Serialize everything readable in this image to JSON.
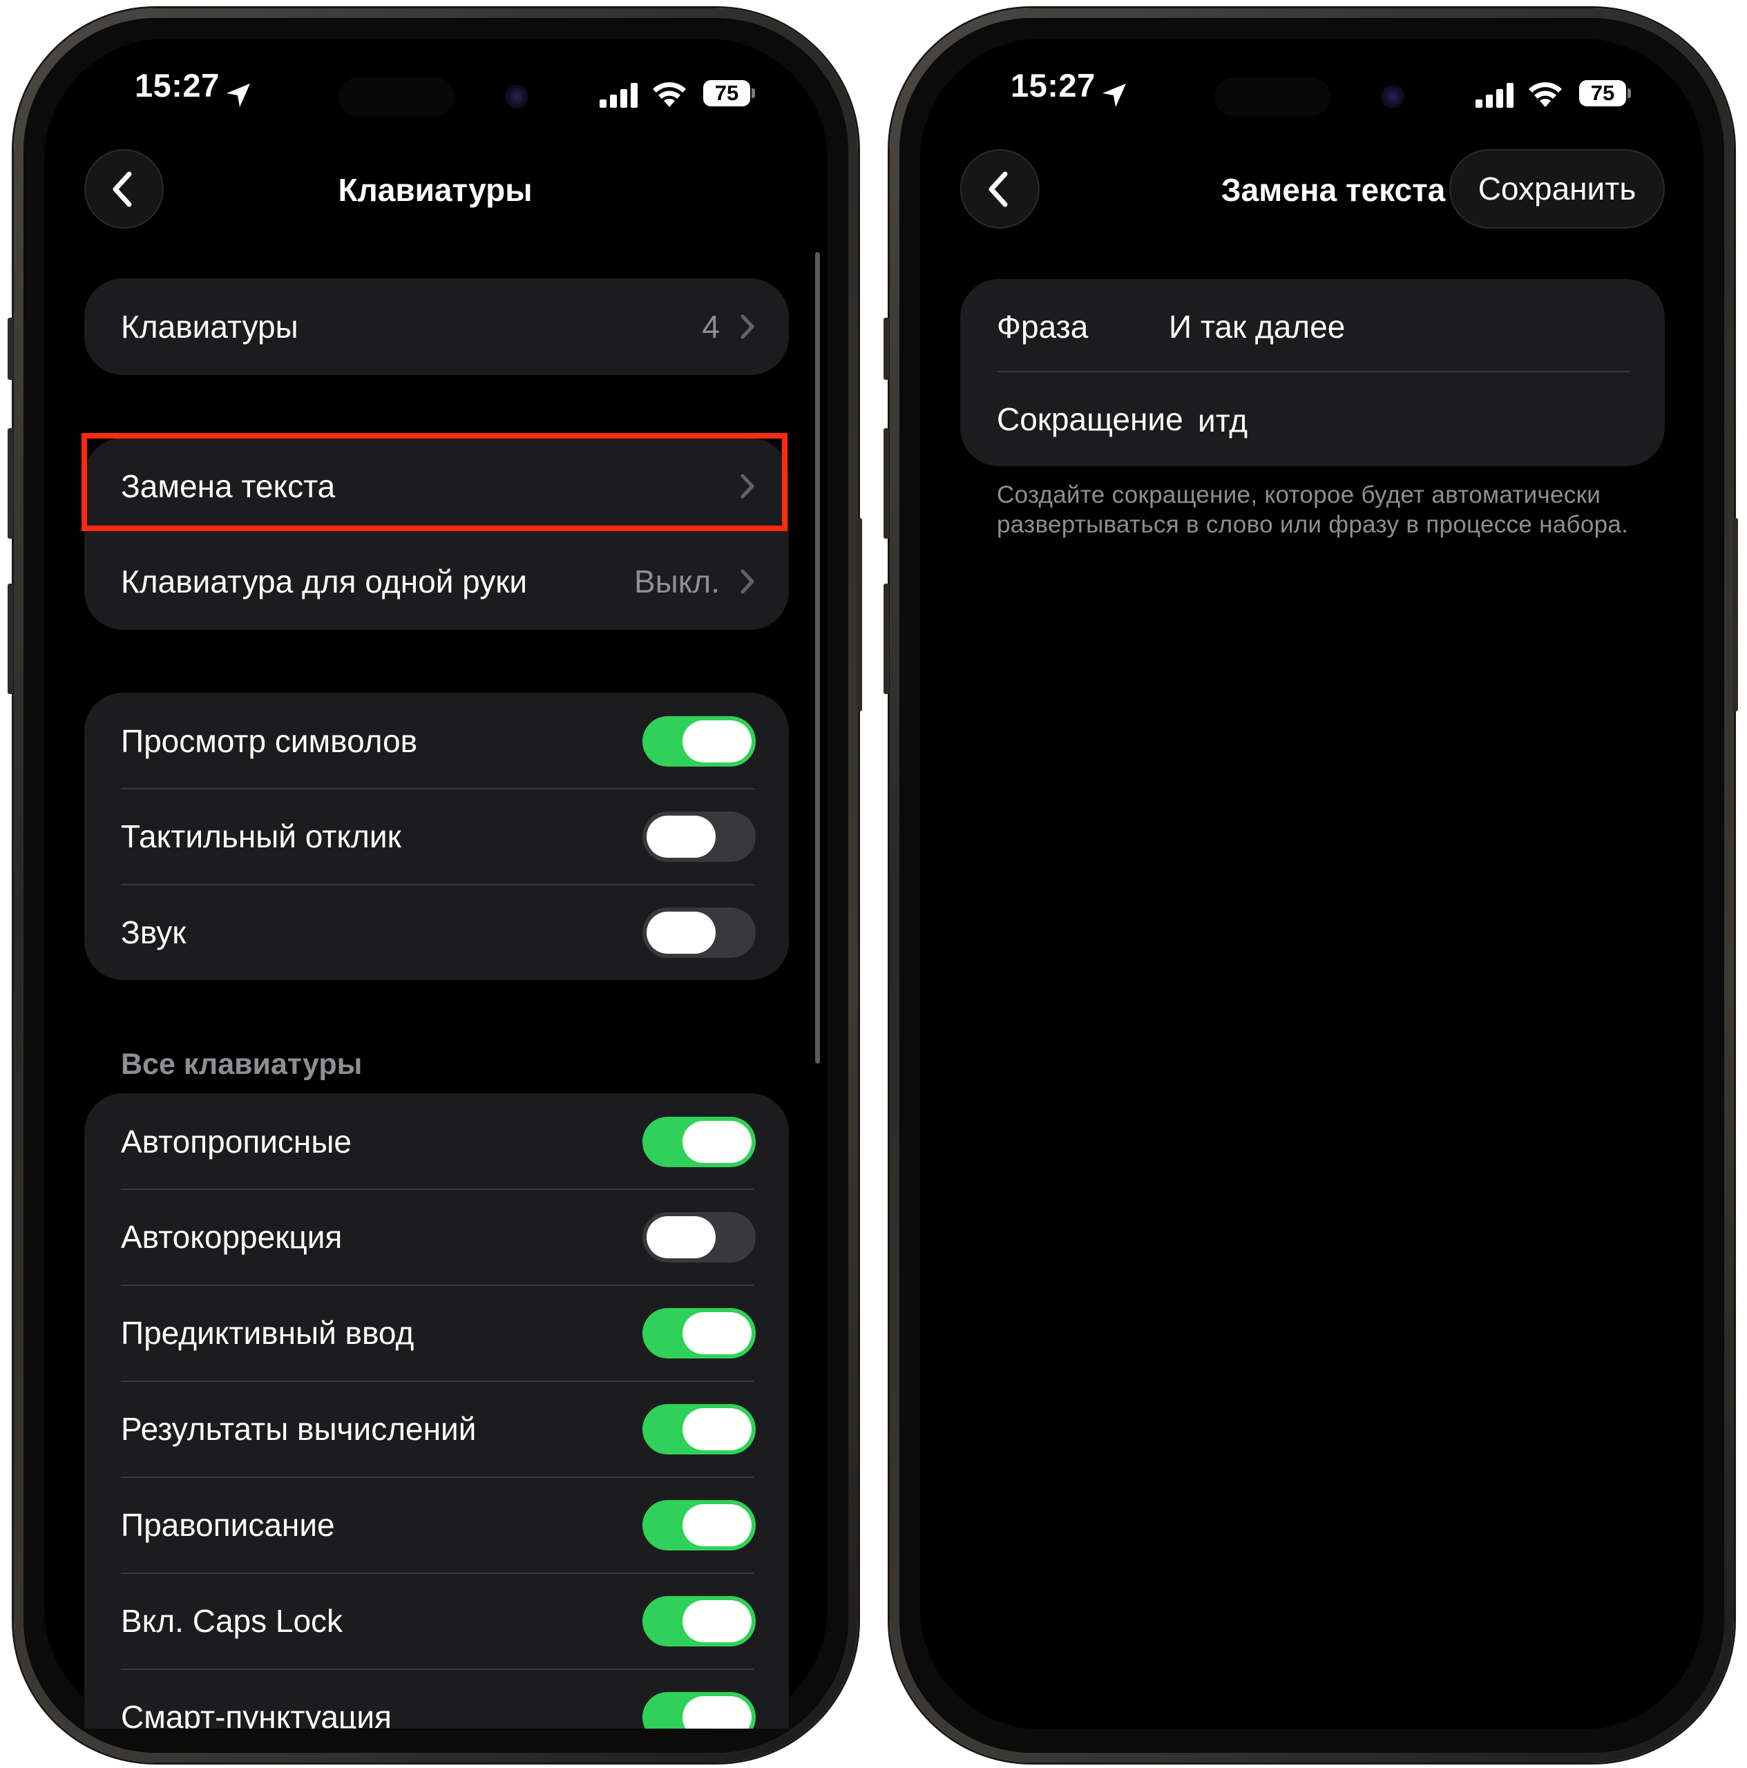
{
  "left": {
    "status": {
      "time": "15:27",
      "battery": "75"
    },
    "nav": {
      "title": "Клавиатуры"
    },
    "group1": {
      "label": "Клавиатуры",
      "value": "4"
    },
    "group2": {
      "text_replacement": "Замена текста",
      "one_handed_label": "Клавиатура для одной руки",
      "one_handed_value": "Выкл."
    },
    "group3": [
      {
        "label": "Просмотр символов",
        "on": true
      },
      {
        "label": "Тактильный отклик",
        "on": false
      },
      {
        "label": "Звук",
        "on": false
      }
    ],
    "all_keyboards_header": "Все клавиатуры",
    "group4": [
      {
        "label": "Автопрописные",
        "on": true
      },
      {
        "label": "Автокоррекция",
        "on": false
      },
      {
        "label": "Предиктивный ввод",
        "on": true
      },
      {
        "label": "Результаты вычислений",
        "on": true
      },
      {
        "label": "Правописание",
        "on": true
      },
      {
        "label": "Вкл. Caps Lock",
        "on": true
      },
      {
        "label": "Смарт-пунктуация",
        "on": true
      }
    ]
  },
  "right": {
    "status": {
      "time": "15:27",
      "battery": "75"
    },
    "nav": {
      "title": "Замена текста",
      "save": "Сохранить"
    },
    "phrase_label": "Фраза",
    "phrase_value": "И так далее",
    "shortcut_label": "Сокращение",
    "shortcut_value": "итд",
    "footer": "Создайте сокращение, которое будет автоматически развертываться в слово или фразу в процессе набора."
  },
  "colors": {
    "background": "#000000",
    "group": "#1c1c1e",
    "toggle_on": "#30d158",
    "toggle_off": "#39393d",
    "secondary_text": "#8e8e93",
    "highlight": "#ff2a12"
  },
  "icons": [
    "back-chevron-icon",
    "chevron-right-icon",
    "location-arrow-icon",
    "cellular-signal-icon",
    "wifi-icon",
    "battery-icon"
  ]
}
